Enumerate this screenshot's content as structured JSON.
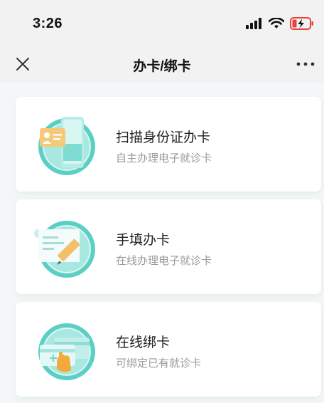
{
  "status_bar": {
    "time": "3:26"
  },
  "nav": {
    "title": "办卡/绑卡"
  },
  "options": [
    {
      "title": "扫描身份证办卡",
      "subtitle": "自主办理电子就诊卡",
      "icon": "id-card-scan-icon"
    },
    {
      "title": "手填办卡",
      "subtitle": "在线办理电子就诊卡",
      "icon": "fill-form-icon"
    },
    {
      "title": "在线绑卡",
      "subtitle": "可绑定已有就诊卡",
      "icon": "bind-card-icon"
    }
  ],
  "colors": {
    "accent": "#5ccfc4",
    "battery": "#e8443a"
  }
}
